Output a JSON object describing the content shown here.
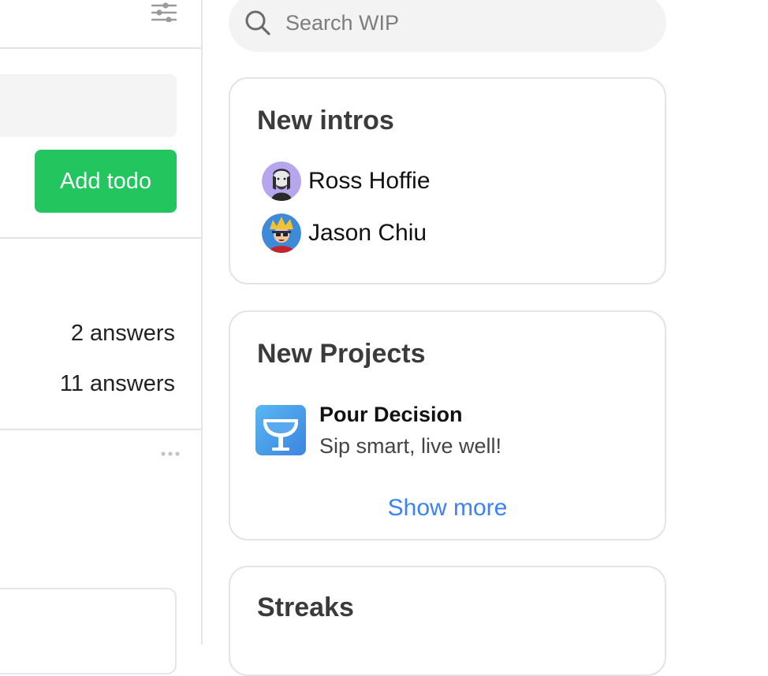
{
  "todo": {
    "input_value": "",
    "add_button_label": "Add todo"
  },
  "questions": {
    "answer_counts": [
      "2 answers",
      "11 answers"
    ]
  },
  "search": {
    "placeholder": "Search WIP",
    "icon": "search-icon"
  },
  "sidebar": {
    "intros": {
      "title": "New intros",
      "people": [
        {
          "name": "Ross Hoffie",
          "avatar": "avatar-ross"
        },
        {
          "name": "Jason Chiu",
          "avatar": "avatar-jason"
        }
      ]
    },
    "projects": {
      "title": "New Projects",
      "items": [
        {
          "name": "Pour Decision",
          "tagline": "Sip smart, live well!",
          "logo": "wine-glass-icon"
        }
      ],
      "show_more_label": "Show more"
    },
    "streaks": {
      "title": "Streaks"
    }
  },
  "colors": {
    "accent_green": "#22c55e",
    "link_blue": "#3b82f6",
    "border": "#e4e4e4"
  }
}
